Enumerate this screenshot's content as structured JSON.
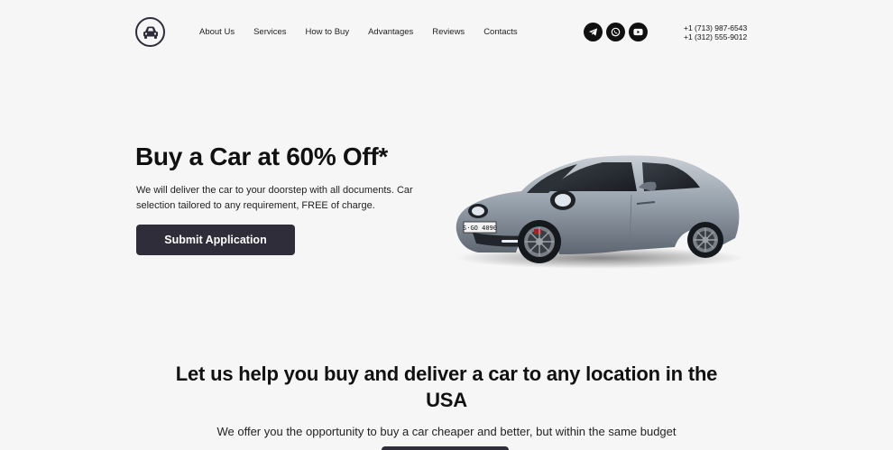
{
  "header": {
    "logo_icon": "car-icon",
    "nav": [
      "About Us",
      "Services",
      "How to Buy",
      "Advantages",
      "Reviews",
      "Contacts"
    ],
    "social": [
      "telegram-icon",
      "whatsapp-icon",
      "youtube-icon"
    ],
    "phones": [
      "+1 (713) 987-6543",
      "+1 (312) 555-9012"
    ]
  },
  "hero": {
    "title": "Buy a Car at 60% Off*",
    "subtitle": "We will deliver the car to your doorstep with all documents. Car selection tailored to any requirement, FREE of charge.",
    "button": "Submit Application",
    "plate": "S·GO 4090"
  },
  "section": {
    "title_line1": "Let us help you buy and deliver a car to any location in the",
    "title_line2": "USA",
    "subtitle": "We offer you the opportunity to buy a car cheaper and better, but within the same budget"
  },
  "colors": {
    "dark": "#2f2d3a",
    "background": "#f6f6f7"
  }
}
